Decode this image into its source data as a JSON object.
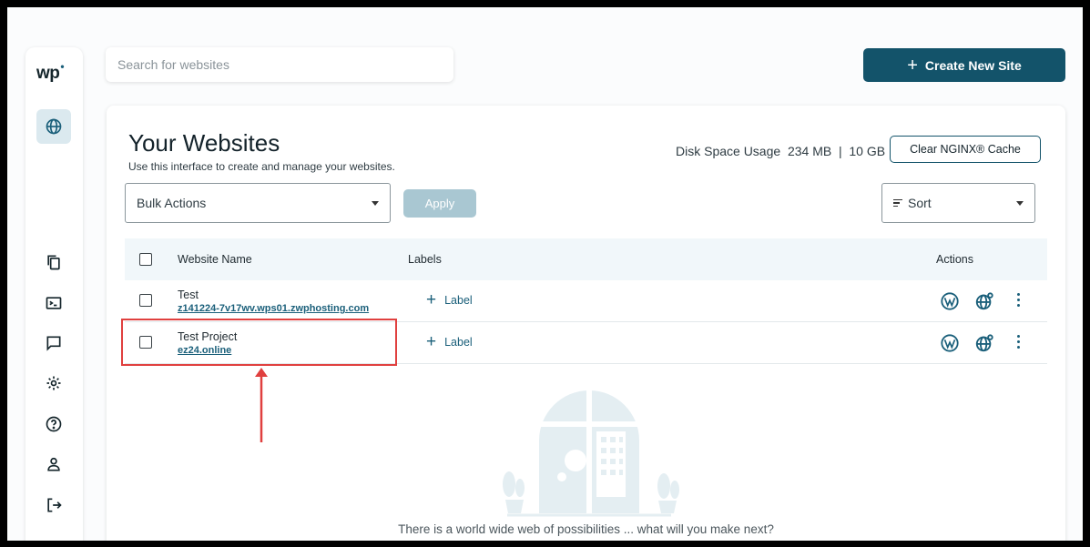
{
  "sidebar": {
    "logo": "wp",
    "items": [
      {
        "icon": "globe-icon",
        "active": true
      },
      {
        "icon": "copy-icon"
      },
      {
        "icon": "terminal-icon"
      },
      {
        "icon": "chat-icon"
      },
      {
        "icon": "gear-icon"
      },
      {
        "icon": "help-icon"
      },
      {
        "icon": "user-icon"
      },
      {
        "icon": "logout-icon"
      }
    ]
  },
  "search": {
    "placeholder": "Search for websites"
  },
  "create_button": {
    "label": "Create New Site"
  },
  "main": {
    "title": "Your Websites",
    "subtitle": "Use this interface to create and manage your websites.",
    "disk_usage": "Disk Space Usage  234 MB  |  10 GB",
    "clear_cache_label": "Clear NGINX® Cache",
    "bulk_actions": "Bulk Actions",
    "apply_label": "Apply",
    "sort_label": "Sort",
    "table": {
      "columns": [
        "Website Name",
        "Labels",
        "Actions"
      ],
      "rows": [
        {
          "name": "Test",
          "url": "z141224-7v17wv.wps01.zwphosting.com",
          "label": "Label"
        },
        {
          "name": "Test Project",
          "url": "ez24.online",
          "label": "Label"
        }
      ]
    },
    "empty_message": "There is a world wide web of possibilities ... what will you make next?"
  },
  "colors": {
    "brand": "#13536a",
    "accent": "#1a5f7a",
    "highlight": "#e0403f"
  }
}
